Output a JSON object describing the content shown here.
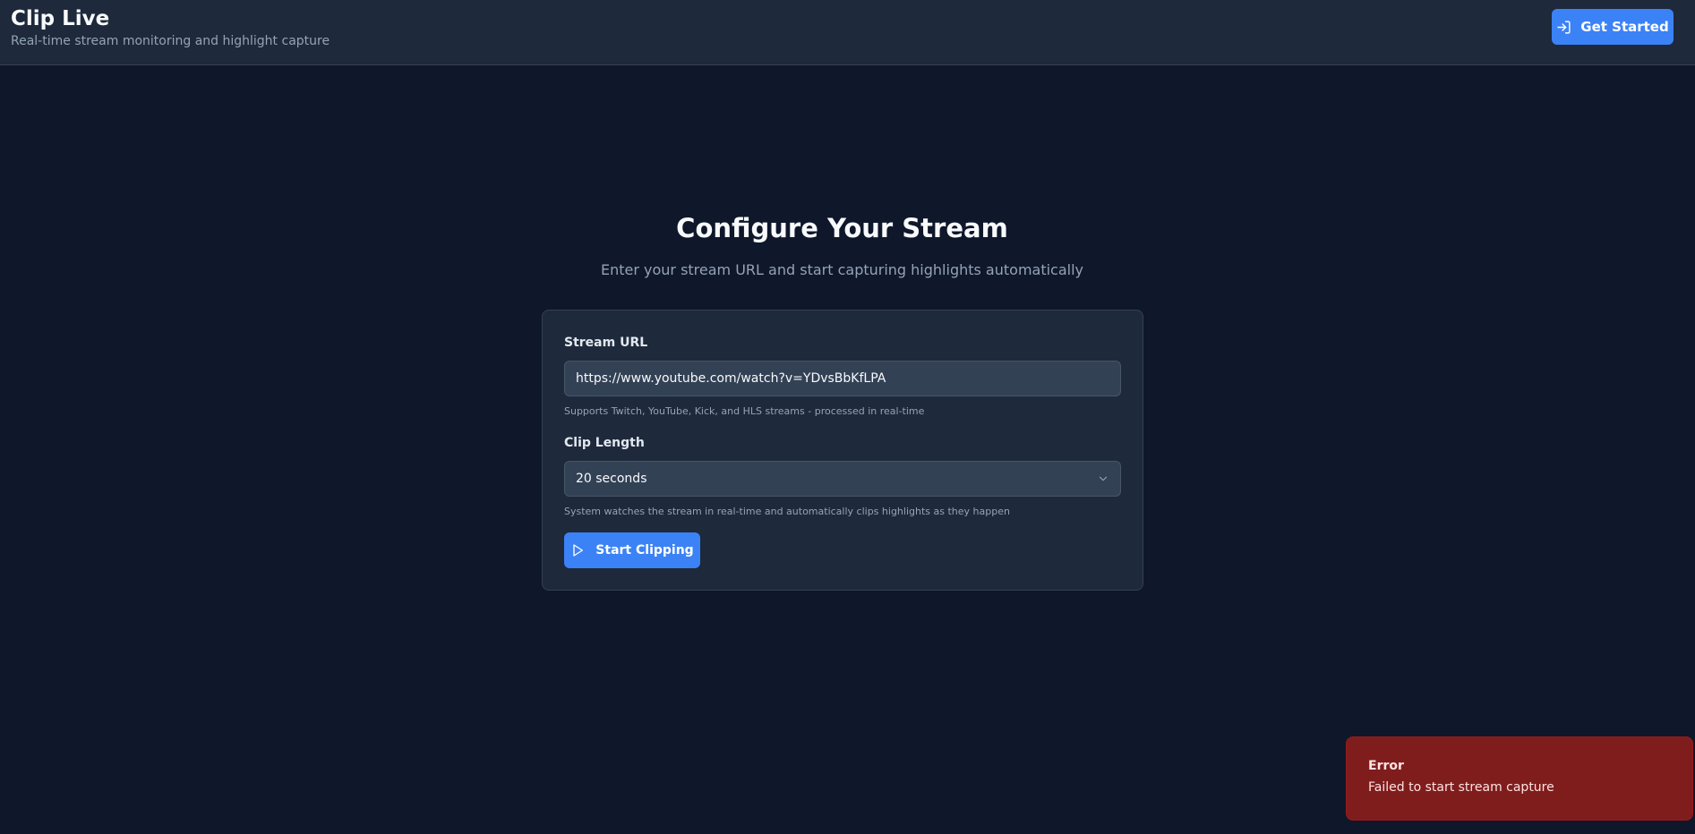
{
  "header": {
    "title": "Clip Live",
    "subtitle": "Real-time stream monitoring and highlight capture",
    "get_started_label": "Get Started",
    "get_started_icon": "log-in-icon"
  },
  "main": {
    "title": "Configure Your Stream",
    "subtitle": "Enter your stream URL and start capturing highlights automatically"
  },
  "form": {
    "stream_url_label": "Stream URL",
    "stream_url_value": "https://www.youtube.com/watch?v=YDvsBbKfLPA",
    "stream_url_helper": "Supports Twitch, YouTube, Kick, and HLS streams - processed in real-time",
    "clip_length_label": "Clip Length",
    "clip_length_value": "20 seconds",
    "clip_length_helper": "System watches the stream in real-time and automatically clips highlights as they happen",
    "start_label": "Start Clipping",
    "start_icon": "play-icon"
  },
  "toast": {
    "title": "Error",
    "message": "Failed to start stream capture"
  },
  "colors": {
    "background": "#0f172a",
    "surface": "#1e293b",
    "accent": "#3b82f6",
    "error": "#7f1d1d"
  }
}
